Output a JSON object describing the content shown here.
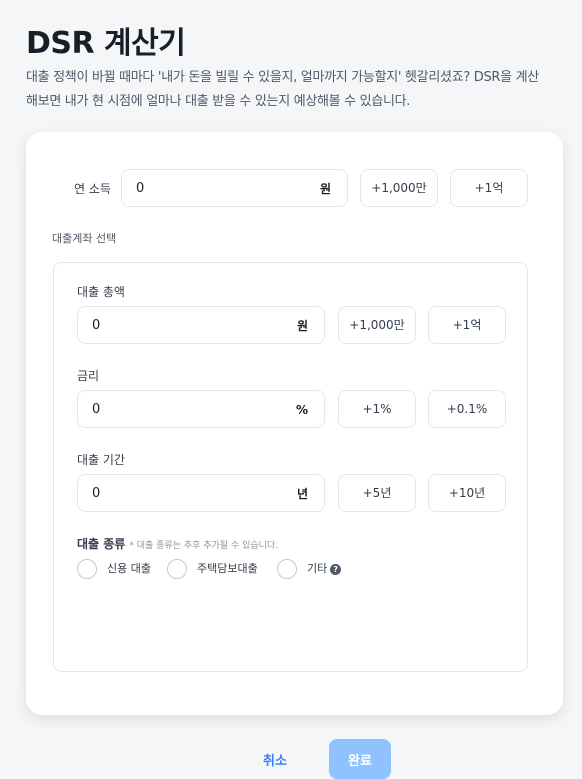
{
  "header": {
    "title": "DSR 계산기",
    "description": "대출 정책이 바뀔 때마다 '내가 돈을 빌릴 수 있을지, 얼마까지 가능할지' 헷갈리셨죠? DSR을 계산해보면 내가 현 시점에 얼마나 대출 받을 수 있는지 예상해볼 수 있습니다."
  },
  "income": {
    "label": "연 소득",
    "value": "0",
    "unit": "원",
    "quick_buttons": [
      "+1,000만",
      "+1억"
    ]
  },
  "loan_account": {
    "label": "대출계좌 선택",
    "amount": {
      "label": "대출 총액",
      "value": "0",
      "unit": "원",
      "quick_buttons": [
        "+1,000만",
        "+1억"
      ]
    },
    "rate": {
      "label": "금리",
      "value": "0",
      "unit": "%",
      "quick_buttons": [
        "+1%",
        "+0.1%"
      ]
    },
    "period": {
      "label": "대출 기간",
      "value": "0",
      "unit": "년",
      "quick_buttons": [
        "+5년",
        "+10년"
      ]
    },
    "type": {
      "label": "대출 종류",
      "note": "* 대출 종류는 추후 추가될 수 있습니다.",
      "options": [
        "신용 대출",
        "주택담보대출",
        "기타"
      ],
      "help_icon": "question-circle-icon",
      "help_glyph": "?"
    }
  },
  "actions": {
    "cancel_label": "취소",
    "done_label": "완료"
  },
  "colors": {
    "accent": "#3182f6",
    "done_disabled": "#90c2ff",
    "border": "#e5e8eb"
  }
}
